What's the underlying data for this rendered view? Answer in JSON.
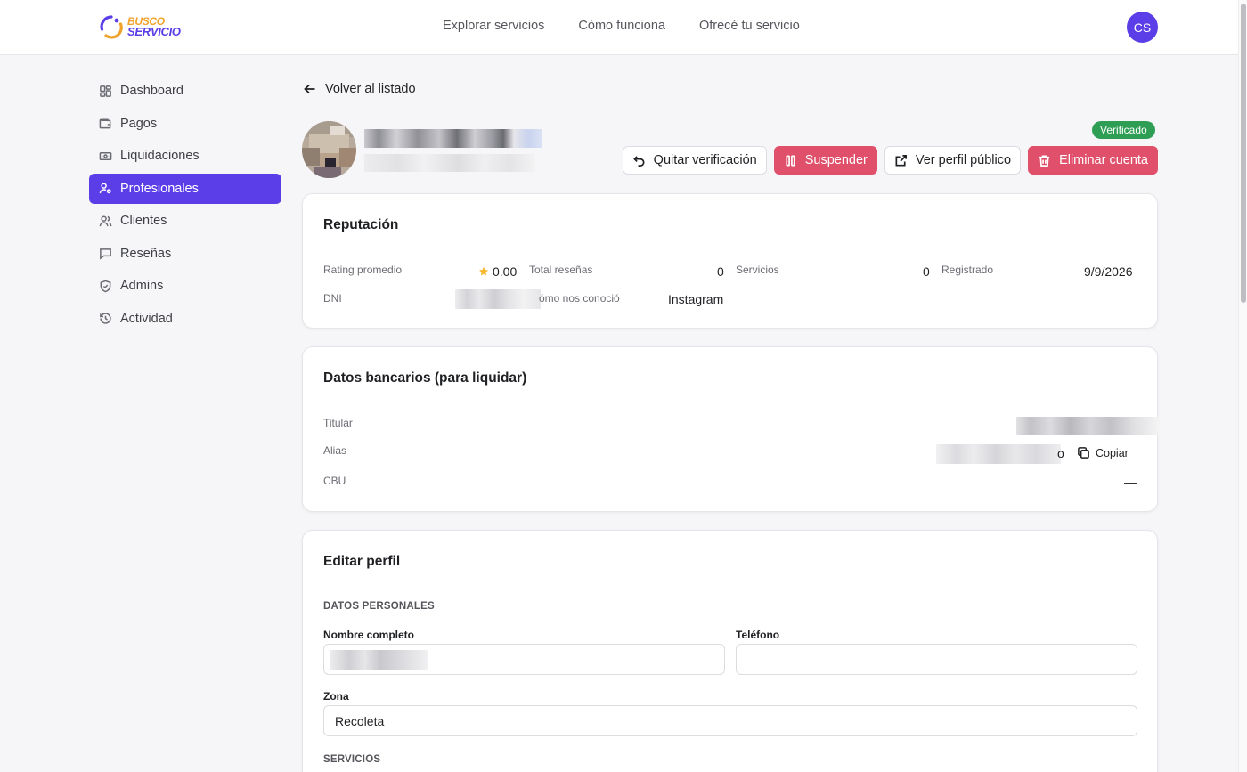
{
  "brand": {
    "line1": "BUSCO",
    "line2": "SERVICIO"
  },
  "topnav": [
    "Explorar servicios",
    "Cómo funciona",
    "Ofrecé tu servicio"
  ],
  "user": {
    "initials": "CS"
  },
  "colors": {
    "accent": "#5b3ee8",
    "danger": "#e0506b",
    "success": "#2f9e55",
    "star": "#f5b82e"
  },
  "sidebar": {
    "items": [
      {
        "label": "Dashboard",
        "icon": "dashboard-icon"
      },
      {
        "label": "Pagos",
        "icon": "wallet-icon"
      },
      {
        "label": "Liquidaciones",
        "icon": "banknote-icon"
      },
      {
        "label": "Profesionales",
        "icon": "user-cog-icon",
        "active": true
      },
      {
        "label": "Clientes",
        "icon": "users-icon"
      },
      {
        "label": "Reseñas",
        "icon": "message-icon"
      },
      {
        "label": "Admins",
        "icon": "shield-icon"
      },
      {
        "label": "Actividad",
        "icon": "history-icon"
      }
    ]
  },
  "back_label": "Volver al listado",
  "badge": "Verificado",
  "actions": {
    "unverify": "Quitar verificación",
    "suspend": "Suspender",
    "public_profile": "Ver perfil público",
    "delete": "Eliminar cuenta"
  },
  "reputation": {
    "title": "Reputación",
    "rating_label": "Rating promedio",
    "rating_value": "0.00",
    "reviews_label": "Total reseñas",
    "reviews_value": "0",
    "services_label": "Servicios",
    "services_value": "0",
    "registered_label": "Registrado",
    "registered_value": "9/9/2026",
    "dni_label": "DNI",
    "source_label": "ómo nos conoció",
    "source_value": "Instagram"
  },
  "bank": {
    "title": "Datos bancarios (para liquidar)",
    "holder_label": "Titular",
    "alias_label": "Alias",
    "alias_suffix": "o",
    "copy_label": "Copiar",
    "cbu_label": "CBU",
    "cbu_value": "—"
  },
  "edit": {
    "title": "Editar perfil",
    "personal_section": "DATOS PERSONALES",
    "name_label": "Nombre completo",
    "phone_label": "Teléfono",
    "phone_value": "",
    "zone_label": "Zona",
    "zone_value": "Recoleta",
    "services_section": "SERVICIOS"
  }
}
